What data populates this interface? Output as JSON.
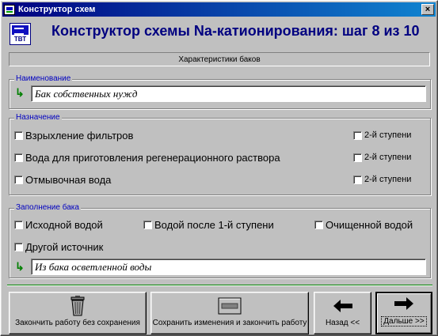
{
  "window": {
    "title": "Конструктор схем",
    "close_label": "×"
  },
  "header": {
    "logo_text": "ТВТ",
    "title": "Конструктор схемы Na-катионирования: шаг 8 из 10"
  },
  "section": {
    "title": "Характеристики баков"
  },
  "name_group": {
    "legend": "Наименование",
    "value": "Бак собственных нужд"
  },
  "purpose_group": {
    "legend": "Назначение",
    "items": [
      {
        "label": "Взрыхление фильтров",
        "checked": false,
        "second_stage_label": "2-й ступени",
        "second_stage_checked": false
      },
      {
        "label": "Вода для приготовления регенерационного раствора",
        "checked": false,
        "second_stage_label": "2-й ступени",
        "second_stage_checked": false
      },
      {
        "label": "Отмывочная вода",
        "checked": false,
        "second_stage_label": "2-й ступени",
        "second_stage_checked": false
      }
    ]
  },
  "fill_group": {
    "legend": "Заполнение бака",
    "options": [
      {
        "label": "Исходной водой",
        "checked": false
      },
      {
        "label": "Водой после 1-й ступени",
        "checked": false
      },
      {
        "label": "Очищенной водой",
        "checked": false
      },
      {
        "label": "Другой источник",
        "checked": false
      }
    ],
    "source_value": "Из бака осветленной воды"
  },
  "buttons": {
    "exit_no_save": "Закончить работу без сохранения",
    "save_and_exit": "Сохранить изменения и закончить работу",
    "back": "Назад <<",
    "next": "Дальше >>"
  },
  "icons": {
    "field_icon": "green-arrow-icon",
    "trash": "trash-can-icon",
    "save": "save-icon",
    "back": "arrow-left-icon",
    "next": "arrow-right-icon"
  }
}
